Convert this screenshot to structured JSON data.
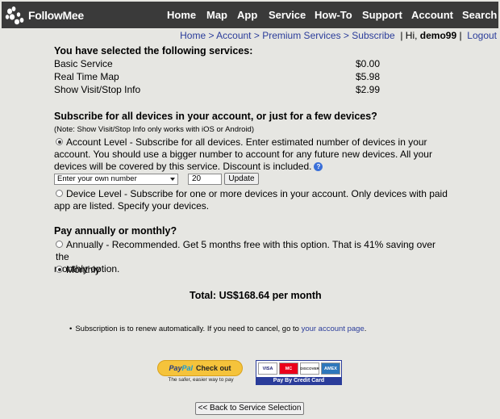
{
  "logo": {
    "text": "FollowMee",
    "icon": "paw-prints-icon"
  },
  "nav": [
    "Home",
    "Map",
    "App",
    "Service",
    "How-To",
    "Support",
    "Account",
    "Search"
  ],
  "breadcrumb": {
    "items": [
      "Home",
      "Account",
      "Premium Services",
      "Subscribe"
    ],
    "separator": ">",
    "greeting": "| Hi,",
    "username": "demo99",
    "divider": "|",
    "logout": "Logout"
  },
  "selected": {
    "heading": "You have selected the following services:",
    "services": [
      {
        "name": "Basic Service",
        "price": "$0.00"
      },
      {
        "name": "Real Time Map",
        "price": "$5.98"
      },
      {
        "name": "Show Visit/Stop Info",
        "price": "$2.99"
      }
    ]
  },
  "devices": {
    "heading": "Subscribe for all devices in your account, or just for a few devices?",
    "note": "(Note: Show Visit/Stop Info only works with iOS or Android)",
    "account_level_lines": [
      "Account Level - Subscribe for all devices. Enter estimated number of devices in your",
      "account. You should use a bigger number to account for any future new devices. All your",
      "devices will be covered by this service. Discount is included."
    ],
    "select_value": "Enter your own number",
    "count_value": "20",
    "update_label": "Update",
    "device_level_lines": [
      "Device Level - Subscribe for one or more devices in your account. Only devices with paid",
      "app are listed. Specify your devices."
    ]
  },
  "billing": {
    "heading": "Pay annually or monthly?",
    "annual_lines": [
      "Annually - Recommended. Get 5 months free with this option. That is 41% saving over the",
      "monthly option."
    ],
    "monthly_label": "Monthly"
  },
  "total": "Total: US$168.64 per month",
  "renew": {
    "text": "Subscription is to renew automatically. If you need to cancel, go to",
    "link": "your account page",
    "end": "."
  },
  "paypal": {
    "pay": "Pay",
    "pal": "Pal",
    "checkout": "Check out",
    "tagline": "The safer, easier way to pay"
  },
  "cards": {
    "brands": [
      "VISA",
      "MC",
      "DISCOVER",
      "AMEX"
    ],
    "label": "Pay By Credit Card"
  },
  "back_label": "<< Back to Service Selection",
  "colors": {
    "nav_bg": "#3a3a3a",
    "link": "#2a3c9a",
    "page_bg": "#e6e6e2",
    "paypal": "#f5c33b"
  }
}
